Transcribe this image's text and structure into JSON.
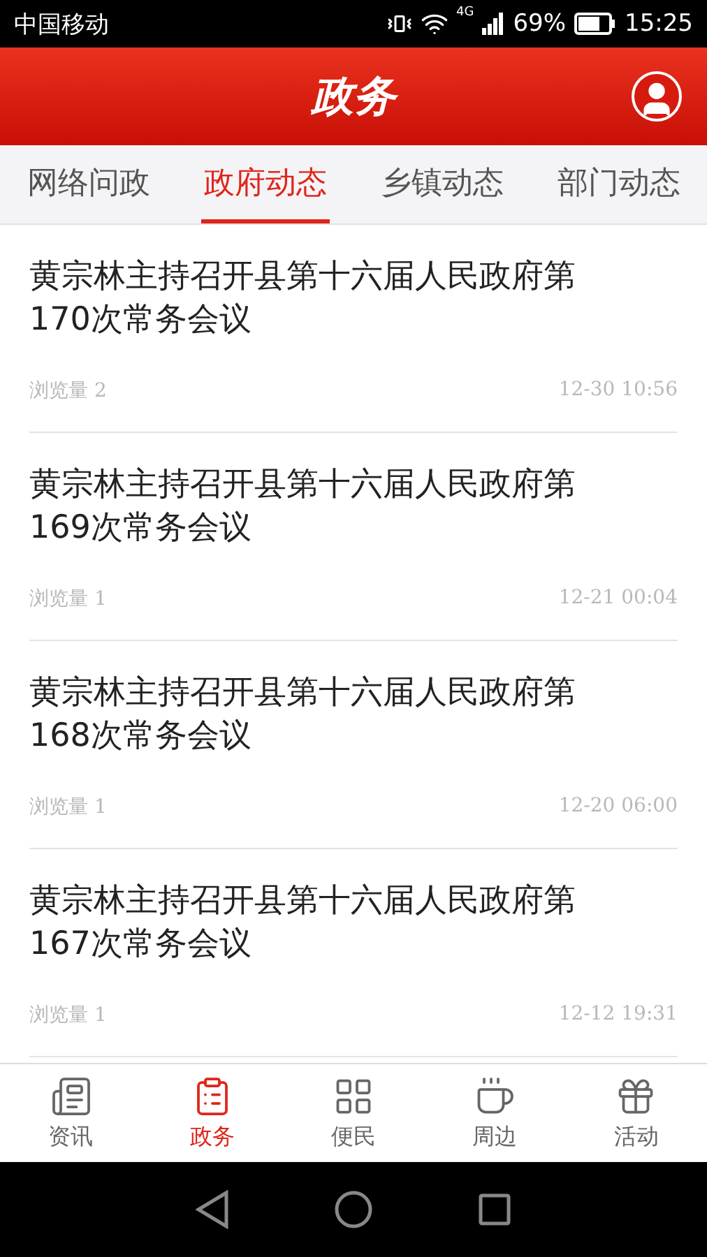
{
  "status_bar": {
    "carrier": "中国移动",
    "network": "4G",
    "battery": "69%",
    "time": "15:25"
  },
  "header": {
    "title": "政务"
  },
  "tabs": [
    {
      "label": "网络问政",
      "selected": false
    },
    {
      "label": "政府动态",
      "selected": true
    },
    {
      "label": "乡镇动态",
      "selected": false
    },
    {
      "label": "部门动态",
      "selected": false
    }
  ],
  "articles": [
    {
      "title": "黄宗林主持召开县第十六届人民政府第170次常务会议",
      "views": "浏览量 2",
      "time": "12-30 10:56"
    },
    {
      "title": "黄宗林主持召开县第十六届人民政府第169次常务会议",
      "views": "浏览量 1",
      "time": "12-21 00:04"
    },
    {
      "title": "黄宗林主持召开县第十六届人民政府第168次常务会议",
      "views": "浏览量 1",
      "time": "12-20 06:00"
    },
    {
      "title": "黄宗林主持召开县第十六届人民政府第167次常务会议",
      "views": "浏览量 1",
      "time": "12-12 19:31"
    }
  ],
  "bottom_nav": [
    {
      "label": "资讯",
      "selected": false
    },
    {
      "label": "政务",
      "selected": true
    },
    {
      "label": "便民",
      "selected": false
    },
    {
      "label": "周边",
      "selected": false
    },
    {
      "label": "活动",
      "selected": false
    }
  ]
}
